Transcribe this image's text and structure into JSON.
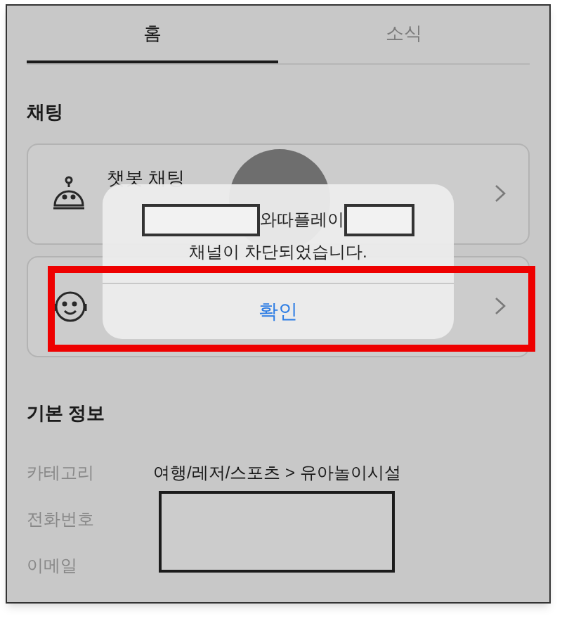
{
  "tabs": [
    {
      "label": "홈",
      "selected": true
    },
    {
      "label": "소식",
      "selected": false
    }
  ],
  "chat_section": {
    "title": "채팅",
    "items": [
      {
        "kind": "bot",
        "title": "챗봇 채팅"
      },
      {
        "kind": "agent"
      }
    ]
  },
  "basic_info": {
    "title": "기본 정보",
    "rows": [
      {
        "label": "카테고리",
        "value": "여행/레저/스포츠 > 유아놀이시설"
      },
      {
        "label": "전화번호"
      },
      {
        "label": "이메일"
      }
    ]
  },
  "dialog": {
    "message_part": "와따플레이",
    "message_line": "채널이 차단되었습니다.",
    "button": "확인"
  }
}
